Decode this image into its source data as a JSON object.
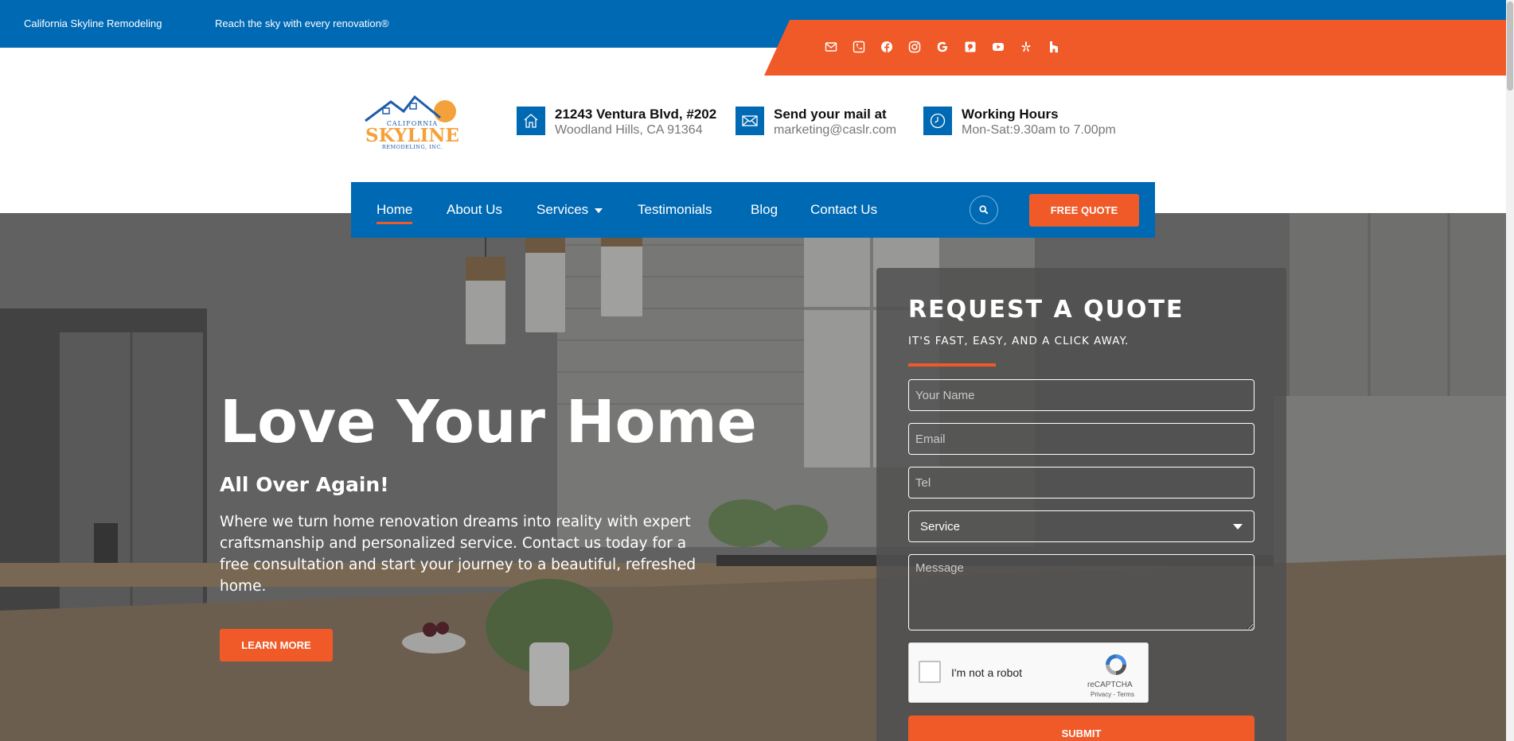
{
  "topbar": {
    "brand": "California Skyline Remodeling",
    "tagline": "Reach the sky with every renovation®",
    "social_icons": [
      "mail-icon",
      "phone-icon",
      "facebook-icon",
      "instagram-icon",
      "google-icon",
      "houzz-alt-icon",
      "youtube-icon",
      "yelp-icon",
      "houzz-icon"
    ]
  },
  "logo": {
    "line1": "CALIFORNIA",
    "line2": "SKYLINE",
    "line3": "REMODELING, INC."
  },
  "contact": {
    "address_title": "21243 Ventura Blvd, #202",
    "address_sub": "Woodland Hills, CA 91364",
    "mail_title": "Send your mail at",
    "mail_sub": "marketing@caslr.com",
    "hours_title": "Working Hours",
    "hours_sub": "Mon-Sat:9.30am to 7.00pm"
  },
  "nav": {
    "items": [
      {
        "label": "Home"
      },
      {
        "label": "About Us"
      },
      {
        "label": "Services"
      },
      {
        "label": "Testimonials"
      },
      {
        "label": "Blog"
      },
      {
        "label": "Contact Us"
      }
    ],
    "quote_label": "FREE QUOTE"
  },
  "hero": {
    "title": "Love Your Home",
    "subtitle": "All Over Again!",
    "description": "Where we turn home renovation dreams into reality with expert craftsmanship and personalized service. Contact us today for a free consultation and start your journey to a beautiful, refreshed home.",
    "cta": "LEARN MORE"
  },
  "quote_form": {
    "title": "REQUEST A QUOTE",
    "subtitle": "IT'S FAST, EASY, AND A CLICK AWAY.",
    "name_placeholder": "Your Name",
    "email_placeholder": "Email",
    "tel_placeholder": "Tel",
    "service_value": "Service",
    "message_placeholder": "Message",
    "recaptcha_label": "I'm not a robot",
    "recaptcha_brand": "reCAPTCHA",
    "recaptcha_terms": "Privacy - Terms",
    "submit": "SUBMIT"
  },
  "colors": {
    "brand_blue": "#0069b4",
    "accent_orange": "#f05a28"
  }
}
